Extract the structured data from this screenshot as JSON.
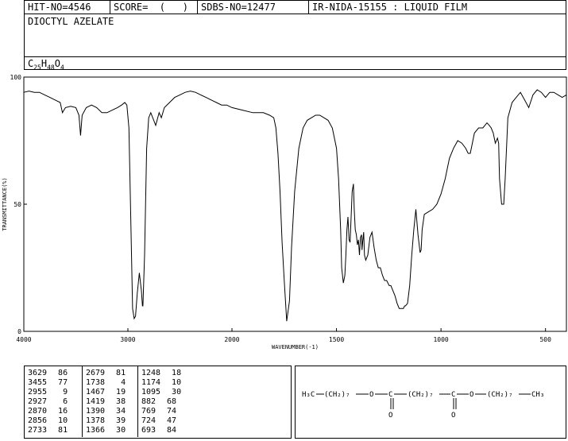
{
  "header": {
    "hit": "HIT-NO=4546",
    "score": "SCORE=  (   )",
    "sdbs": "SDBS-NO=12477",
    "nida": "IR-NIDA-15155 : LIQUID FILM",
    "compound": "DIOCTYL AZELATE",
    "formula_parts": [
      "C",
      "25",
      "H",
      "48",
      "O",
      "4"
    ]
  },
  "chart_data": {
    "type": "line",
    "title": "",
    "xlabel": "WAVENUMBER(-1)",
    "ylabel": "TRANSMITTANCE(%)",
    "xlim": [
      4000,
      400
    ],
    "ylim": [
      0,
      100
    ],
    "xticks": [
      "4000",
      "3000",
      "2000",
      "1500",
      "1000",
      "500"
    ],
    "xtick_values": [
      4000,
      3000,
      2000,
      1500,
      1000,
      500
    ],
    "yticks": [
      "0",
      "50",
      "100"
    ],
    "ytick_values": [
      0,
      50,
      100
    ],
    "x": [
      4000,
      3950,
      3900,
      3850,
      3800,
      3750,
      3700,
      3650,
      3629,
      3600,
      3550,
      3500,
      3470,
      3455,
      3440,
      3400,
      3350,
      3300,
      3250,
      3200,
      3150,
      3100,
      3060,
      3030,
      3010,
      2990,
      2970,
      2955,
      2940,
      2927,
      2910,
      2890,
      2870,
      2860,
      2856,
      2840,
      2820,
      2800,
      2780,
      2733,
      2700,
      2679,
      2650,
      2600,
      2550,
      2500,
      2450,
      2400,
      2350,
      2300,
      2250,
      2200,
      2150,
      2100,
      2050,
      2000,
      1950,
      1900,
      1850,
      1820,
      1800,
      1790,
      1780,
      1770,
      1760,
      1750,
      1738,
      1725,
      1715,
      1700,
      1680,
      1660,
      1640,
      1620,
      1600,
      1580,
      1560,
      1540,
      1520,
      1500,
      1490,
      1480,
      1475,
      1467,
      1460,
      1455,
      1450,
      1445,
      1440,
      1435,
      1430,
      1425,
      1419,
      1415,
      1410,
      1405,
      1400,
      1395,
      1390,
      1385,
      1380,
      1378,
      1375,
      1370,
      1366,
      1360,
      1350,
      1340,
      1330,
      1320,
      1310,
      1300,
      1290,
      1280,
      1270,
      1260,
      1248,
      1240,
      1230,
      1220,
      1210,
      1200,
      1190,
      1180,
      1174,
      1170,
      1160,
      1150,
      1140,
      1130,
      1120,
      1110,
      1100,
      1095,
      1090,
      1080,
      1060,
      1040,
      1020,
      1000,
      980,
      960,
      940,
      920,
      900,
      882,
      870,
      860,
      840,
      820,
      800,
      790,
      780,
      769,
      760,
      750,
      740,
      730,
      724,
      720,
      710,
      700,
      693,
      680,
      660,
      640,
      620,
      600,
      580,
      560,
      540,
      520,
      500,
      480,
      460,
      440,
      420,
      400
    ],
    "y": [
      94,
      94.5,
      94,
      94,
      93,
      92,
      91,
      90,
      86,
      88,
      88.5,
      88,
      85,
      77,
      85,
      88,
      89,
      88,
      86,
      86,
      87,
      88,
      89,
      90,
      89,
      80,
      40,
      9,
      5,
      6,
      15,
      23,
      16,
      10,
      10,
      30,
      72,
      84,
      86,
      81,
      86,
      84,
      88,
      90,
      92,
      93,
      94,
      94.5,
      94,
      93,
      92,
      91,
      90,
      89,
      89,
      88,
      87,
      86,
      86,
      85,
      84,
      80,
      70,
      55,
      35,
      20,
      4,
      12,
      33,
      55,
      72,
      80,
      83,
      84,
      85,
      85,
      84,
      83,
      80,
      72,
      60,
      40,
      25,
      19,
      22,
      30,
      40,
      45,
      36,
      35,
      45,
      55,
      58,
      48,
      40,
      38,
      34,
      36,
      30,
      37,
      38,
      32,
      35,
      39,
      30,
      28,
      30,
      37,
      39,
      33,
      28,
      25,
      25,
      22,
      20,
      20,
      18,
      18,
      16,
      14,
      11,
      9,
      9,
      9,
      10,
      10,
      11,
      18,
      30,
      40,
      48,
      38,
      31,
      32,
      40,
      46,
      47,
      48,
      50,
      54,
      60,
      68,
      72,
      75,
      74,
      72,
      70,
      70,
      78,
      80,
      80,
      81,
      82,
      81,
      80,
      78,
      74,
      76,
      74,
      60,
      50,
      50,
      60,
      84,
      90,
      92,
      94,
      91,
      88,
      93,
      95,
      94,
      92,
      94,
      94,
      93,
      92,
      93,
      90,
      86,
      80
    ]
  },
  "peaks": [
    [
      "3629",
      "86"
    ],
    [
      "3455",
      "77"
    ],
    [
      "2955",
      "9"
    ],
    [
      "2927",
      "6"
    ],
    [
      "2870",
      "16"
    ],
    [
      "2856",
      "10"
    ],
    [
      "2733",
      "81"
    ],
    [
      "2679",
      "81"
    ],
    [
      "1738",
      "4"
    ],
    [
      "1467",
      "19"
    ],
    [
      "1419",
      "38"
    ],
    [
      "1390",
      "34"
    ],
    [
      "1378",
      "39"
    ],
    [
      "1366",
      "30"
    ],
    [
      "1248",
      "18"
    ],
    [
      "1174",
      "10"
    ],
    [
      "1095",
      "30"
    ],
    [
      "882",
      "68"
    ],
    [
      "769",
      "74"
    ],
    [
      "724",
      "47"
    ],
    [
      "693",
      "84"
    ]
  ],
  "structure": {
    "h3c": "H₃C",
    "ch2a": "(CH₂)₇",
    "o1": "O",
    "c1": "C",
    "ch2b": "(CH₂)₇",
    "c2": "C",
    "o2": "O",
    "ch2c": "(CH₂)₇",
    "ch3": "CH₃",
    "oa": "O",
    "ob": "O"
  }
}
